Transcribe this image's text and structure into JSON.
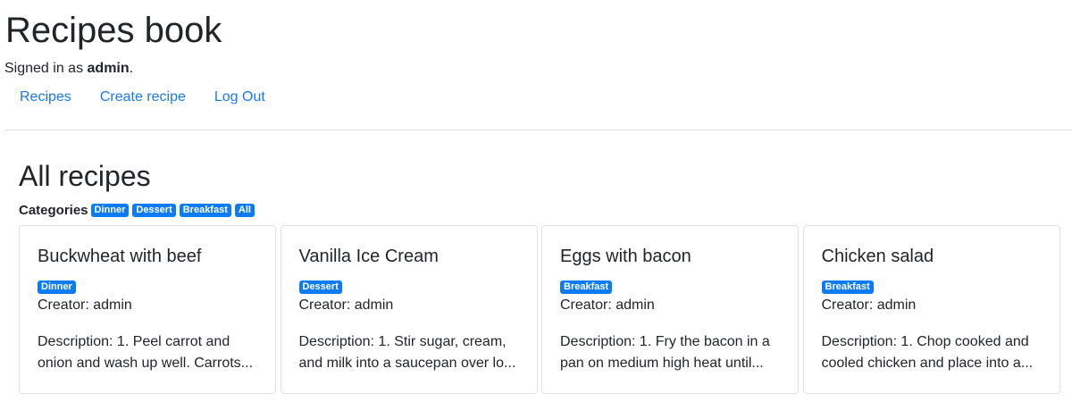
{
  "header": {
    "title": "Recipes book",
    "signed_in_prefix": "Signed in as ",
    "username": "admin",
    "signed_in_suffix": "."
  },
  "nav": {
    "recipes": "Recipes",
    "create_recipe": "Create recipe",
    "log_out": "Log Out"
  },
  "main": {
    "title": "All recipes",
    "categories_label": "Categories",
    "categories": [
      "Dinner",
      "Dessert",
      "Breakfast",
      "All"
    ]
  },
  "recipes": [
    {
      "title": "Buckwheat with beef",
      "category": "Dinner",
      "creator": "Creator: admin",
      "description": "Description: 1. Peel carrot and onion and wash up well. Carrots..."
    },
    {
      "title": "Vanilla Ice Cream",
      "category": "Dessert",
      "creator": "Creator: admin",
      "description": "Description: 1. Stir sugar, cream, and milk into a saucepan over lo..."
    },
    {
      "title": "Eggs with bacon",
      "category": "Breakfast",
      "creator": "Creator: admin",
      "description": "Description: 1. Fry the bacon in a pan on medium high heat until..."
    },
    {
      "title": "Chicken salad",
      "category": "Breakfast",
      "creator": "Creator: admin",
      "description": "Description: 1. Chop cooked and cooled chicken and place into a..."
    }
  ],
  "colors": {
    "link": "#1a7ae8",
    "badge": "#0d7bf4"
  }
}
